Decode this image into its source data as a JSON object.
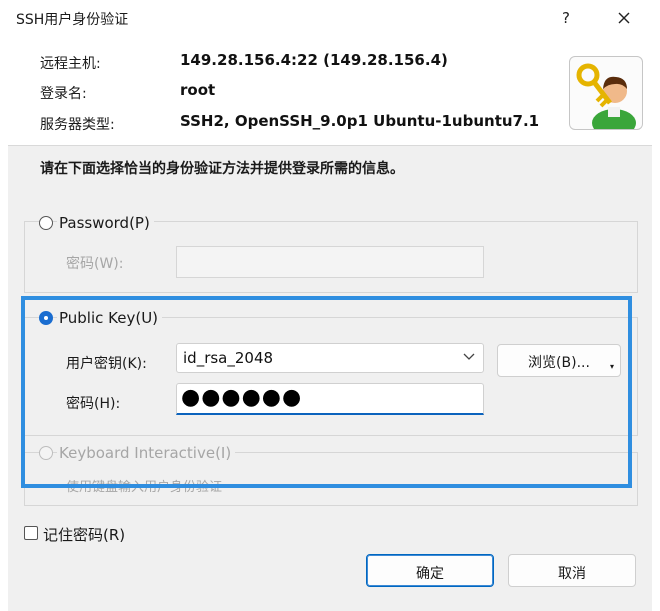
{
  "dialog": {
    "title": "SSH用户身份验证",
    "help_glyph": "?",
    "close_glyph": "×"
  },
  "info": {
    "remote_host_label": "远程主机:",
    "remote_host_value": "149.28.156.4:22 (149.28.156.4)",
    "login_name_label": "登录名:",
    "login_name_value": "root",
    "server_type_label": "服务器类型:",
    "server_type_value": "SSH2, OpenSSH_9.0p1 Ubuntu-1ubuntu7.1",
    "avatar_icon": "user-key-icon"
  },
  "instruction": "请在下面选择恰当的身份验证方法并提供登录所需的信息。",
  "password_method": {
    "label": "Password(P)",
    "selected": false,
    "password_label": "密码(W):"
  },
  "public_key_method": {
    "label": "Public Key(U)",
    "selected": true,
    "user_key_label": "用户密钥(K):",
    "user_key_value": "id_rsa_2048",
    "browse_label": "浏览(B)...",
    "passphrase_label": "密码(H):",
    "passphrase_value": "●●●●●●"
  },
  "keyboard_method": {
    "label": "Keyboard Interactive(I)",
    "selected": false,
    "description": "使用键盘输入用户身份验证"
  },
  "remember_password": {
    "label": "记住密码(R)",
    "checked": false
  },
  "buttons": {
    "ok": "确定",
    "cancel": "取消"
  },
  "colors": {
    "highlight": "#2f8ee0",
    "accent": "#0067c0",
    "body_bg": "#f0f0f0"
  }
}
